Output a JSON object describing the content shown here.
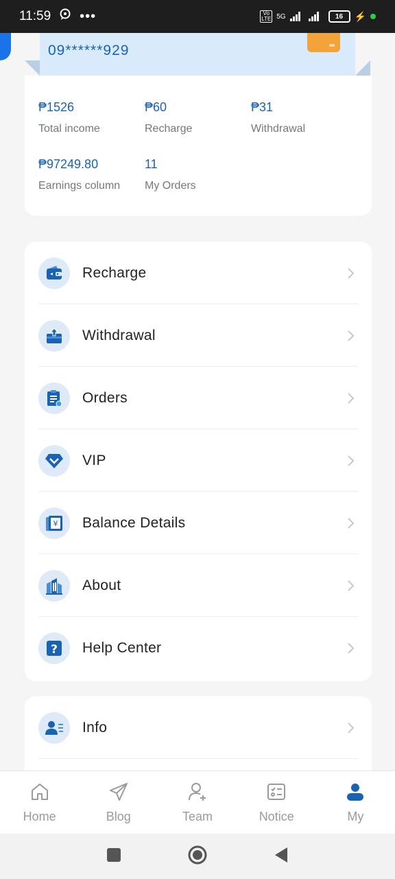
{
  "status": {
    "time": "11:59",
    "battery": "16",
    "network": "5G",
    "volte": "Vo LTE"
  },
  "card": {
    "masked_number": "09******929"
  },
  "stats": [
    {
      "value": "₱1526",
      "label": "Total income"
    },
    {
      "value": "₱60",
      "label": "Recharge"
    },
    {
      "value": "₱31",
      "label": "Withdrawal"
    },
    {
      "value": "₱97249.80",
      "label": "Earnings column"
    },
    {
      "value": "11",
      "label": "My Orders"
    }
  ],
  "menu": [
    {
      "label": "Recharge",
      "icon": "wallet-icon"
    },
    {
      "label": "Withdrawal",
      "icon": "withdraw-icon"
    },
    {
      "label": "Orders",
      "icon": "clipboard-icon"
    },
    {
      "label": "VIP",
      "icon": "diamond-icon"
    },
    {
      "label": "Balance Details",
      "icon": "ledger-icon"
    },
    {
      "label": "About",
      "icon": "building-icon"
    },
    {
      "label": "Help Center",
      "icon": "question-icon"
    }
  ],
  "menu2": [
    {
      "label": "Info",
      "icon": "profile-icon"
    }
  ],
  "tabs": [
    {
      "label": "Home",
      "icon": "home-icon"
    },
    {
      "label": "Blog",
      "icon": "paper-plane-icon"
    },
    {
      "label": "Team",
      "icon": "add-user-icon"
    },
    {
      "label": "Notice",
      "icon": "checklist-icon"
    },
    {
      "label": "My",
      "icon": "person-icon",
      "active": true
    }
  ],
  "colors": {
    "accent": "#1a62b4",
    "icon_bg": "#deeaf7",
    "chip": "#f2a33a",
    "active_tab": "#1a62b4"
  }
}
